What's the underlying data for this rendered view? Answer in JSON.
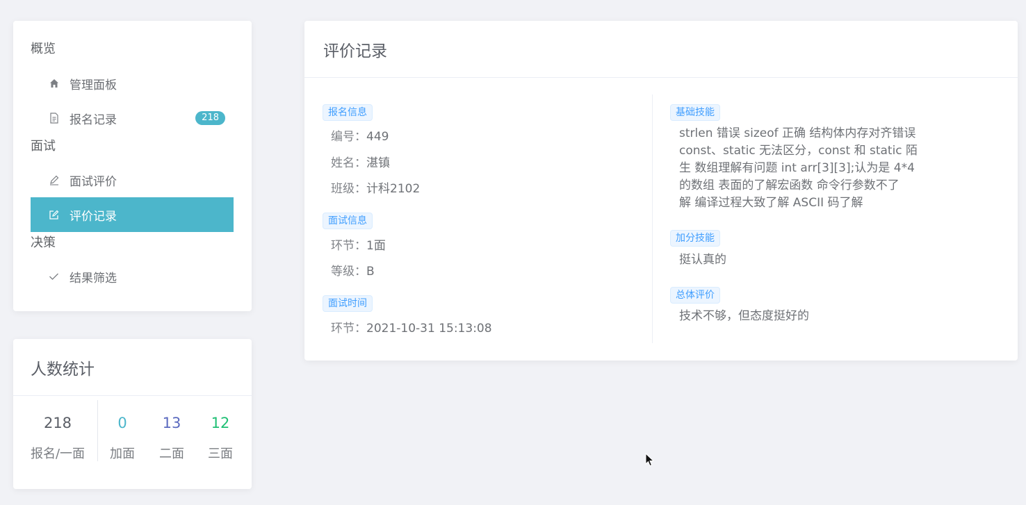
{
  "nav": {
    "groups": [
      {
        "title": "概览"
      },
      {
        "title": "面试"
      },
      {
        "title": "决策"
      }
    ],
    "items": [
      {
        "label": "管理面板",
        "icon": "home-icon"
      },
      {
        "label": "报名记录",
        "icon": "document-icon",
        "badge": "218"
      },
      {
        "label": "面试评价",
        "icon": "edit-pen-icon"
      },
      {
        "label": "评价记录",
        "icon": "edit-square-icon",
        "active": true
      },
      {
        "label": "结果筛选",
        "icon": "check-icon"
      }
    ]
  },
  "stats": {
    "title": "人数统计",
    "items": [
      {
        "value": "218",
        "label": "报名/一面",
        "color": "#5a5e66"
      },
      {
        "value": "0",
        "label": "加面",
        "color": "#4cb6cb"
      },
      {
        "value": "13",
        "label": "二面",
        "color": "#5b6abf"
      },
      {
        "value": "12",
        "label": "三面",
        "color": "#1fbf74"
      }
    ]
  },
  "record": {
    "title": "评价记录",
    "signup": {
      "tag": "报名信息",
      "id_key": "编号：",
      "id_val": "449",
      "name_key": "姓名：",
      "name_val": "湛镇",
      "class_key": "班级：",
      "class_val": "计科2102"
    },
    "interview": {
      "tag": "面试信息",
      "round_key": "环节：",
      "round_val": "1面",
      "grade_key": "等级：",
      "grade_val": "B"
    },
    "time": {
      "tag": "面试时间",
      "key": "环节：",
      "val": "2021-10-31 15:13:08"
    },
    "basic_skills": {
      "tag": "基础技能",
      "lines": [
        "strlen 错误 sizeof 正确 结构体内存对齐错误",
        "const、static 无法区分，const 和 static 陌",
        "生 数组理解有问题 int arr[3][3];认为是 4*4",
        "的数组 表面的了解宏函数 命令行参数不了",
        "解 编译过程大致了解 ASCII 码了解"
      ]
    },
    "bonus_skills": {
      "tag": "加分技能",
      "text": "挺认真的"
    },
    "overall": {
      "tag": "总体评价",
      "text": "技术不够，但态度挺好的"
    }
  },
  "colors": {
    "accent": "#4cb6cb",
    "tag_text": "#409eff",
    "tag_bg": "#ecf5ff"
  }
}
